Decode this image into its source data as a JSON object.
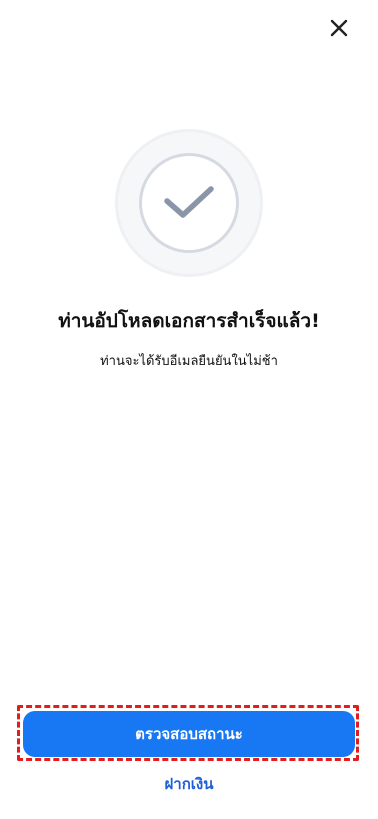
{
  "header": {
    "close_icon": "close-icon"
  },
  "status": {
    "icon": "checkmark-icon",
    "colors": {
      "ring": "#d5d9e1",
      "check": "#8b95a8",
      "halo": "#f6f7f9"
    }
  },
  "content": {
    "title": "ท่านอัปโหลดเอกสารสำเร็จแล้ว!",
    "subtitle": "ท่านจะได้รับอีเมลยืนยันในไม่ช้า"
  },
  "actions": {
    "primary_label": "ตรวจสอบสถานะ",
    "secondary_label": "ฝากเงิน",
    "primary_color": "#1877f2",
    "highlight_color": "#e11d1d"
  }
}
